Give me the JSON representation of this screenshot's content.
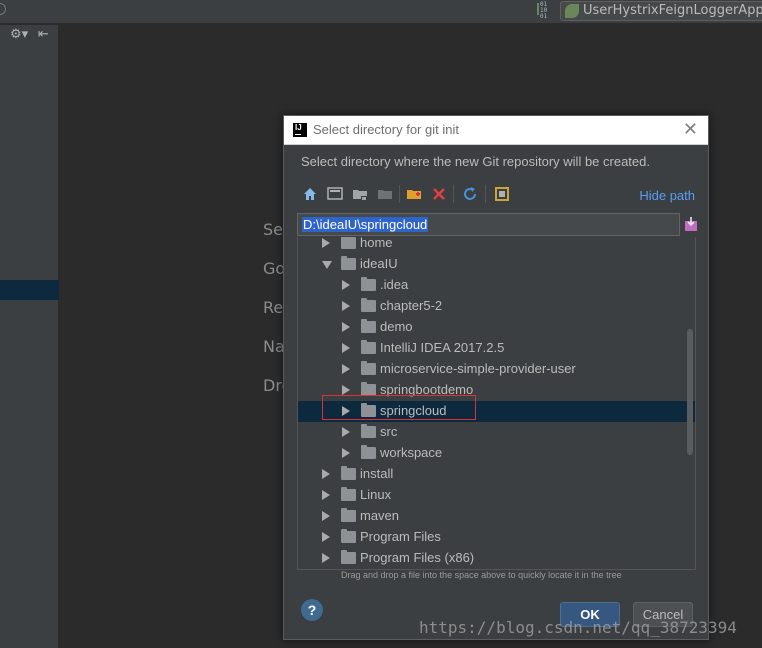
{
  "ide": {
    "run_config_label": "UserHystrixFeignLoggerApplica",
    "binary_icon_text": "01\n10\n01",
    "left_toolbar": {
      "settings_glyph": "⚙▾",
      "collapse_glyph": "⇤"
    },
    "hints": [
      "Search Everywhere",
      "Go to File",
      "Recent Files",
      "Navigation Bar",
      "Drop files here to open"
    ]
  },
  "dialog": {
    "title": "Select directory for git init",
    "logo_text": "IJ",
    "description": "Select directory where the new Git repository will be created.",
    "hide_path_label": "Hide path",
    "path_value": "D:\\ideaIU\\springcloud",
    "drag_hint": "Drag and drop a file into the space above to quickly locate it in the tree",
    "help_label": "?",
    "ok_label": "OK",
    "cancel_label": "Cancel",
    "tree": [
      {
        "label": "home",
        "depth": 0,
        "expanded": false
      },
      {
        "label": "ideaIU",
        "depth": 0,
        "expanded": true
      },
      {
        "label": ".idea",
        "depth": 1,
        "expanded": false
      },
      {
        "label": "chapter5-2",
        "depth": 1,
        "expanded": false
      },
      {
        "label": "demo",
        "depth": 1,
        "expanded": false
      },
      {
        "label": "IntelliJ IDEA 2017.2.5",
        "depth": 1,
        "expanded": false
      },
      {
        "label": "microservice-simple-provider-user",
        "depth": 1,
        "expanded": false
      },
      {
        "label": "springbootdemo",
        "depth": 1,
        "expanded": false
      },
      {
        "label": "springcloud",
        "depth": 1,
        "expanded": false,
        "selected": true
      },
      {
        "label": "src",
        "depth": 1,
        "expanded": false
      },
      {
        "label": "workspace",
        "depth": 1,
        "expanded": false
      },
      {
        "label": "install",
        "depth": 0,
        "expanded": false
      },
      {
        "label": "Linux",
        "depth": 0,
        "expanded": false
      },
      {
        "label": "maven",
        "depth": 0,
        "expanded": false
      },
      {
        "label": "Program Files",
        "depth": 0,
        "expanded": false
      },
      {
        "label": "Program Files (x86)",
        "depth": 0,
        "expanded": false
      }
    ],
    "toolbar_icons": [
      "home-icon",
      "desktop-icon",
      "project-icon",
      "module-icon",
      "new-folder-icon",
      "delete-icon",
      "refresh-icon",
      "show-hidden-icon"
    ]
  },
  "watermark": "https://blog.csdn.net/qq_38723394",
  "colors": {
    "selection": "#0d293e",
    "link": "#589df6",
    "highlight_border": "#d9323a",
    "ok_button": "#365880"
  }
}
